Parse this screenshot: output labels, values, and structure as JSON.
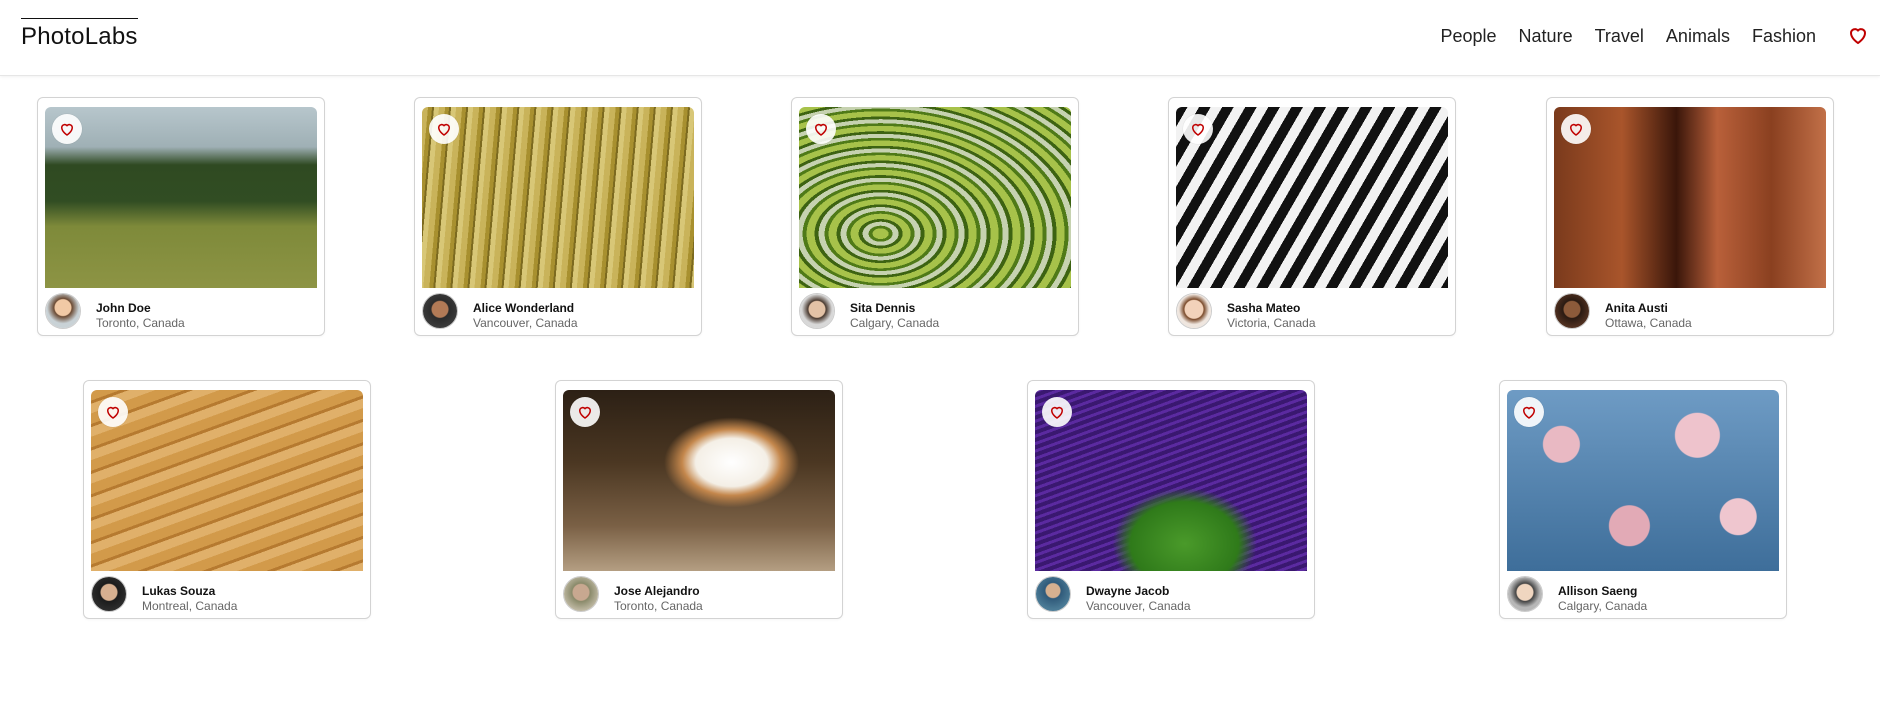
{
  "app": {
    "logo": "PhotoLabs"
  },
  "nav": {
    "topics": [
      "People",
      "Nature",
      "Travel",
      "Animals",
      "Fashion"
    ],
    "favorites_icon": "heart-icon",
    "accent_color": "#c00000"
  },
  "photos": [
    {
      "user": "John Doe",
      "location": "Toronto, Canada"
    },
    {
      "user": "Alice Wonderland",
      "location": "Vancouver, Canada"
    },
    {
      "user": "Sita Dennis",
      "location": "Calgary, Canada"
    },
    {
      "user": "Sasha Mateo",
      "location": "Victoria, Canada"
    },
    {
      "user": "Anita Austi",
      "location": "Ottawa, Canada"
    },
    {
      "user": "Lukas Souza",
      "location": "Montreal, Canada"
    },
    {
      "user": "Jose Alejandro",
      "location": "Toronto, Canada"
    },
    {
      "user": "Dwayne Jacob",
      "location": "Vancouver, Canada"
    },
    {
      "user": "Allison Saeng",
      "location": "Calgary, Canada"
    }
  ]
}
